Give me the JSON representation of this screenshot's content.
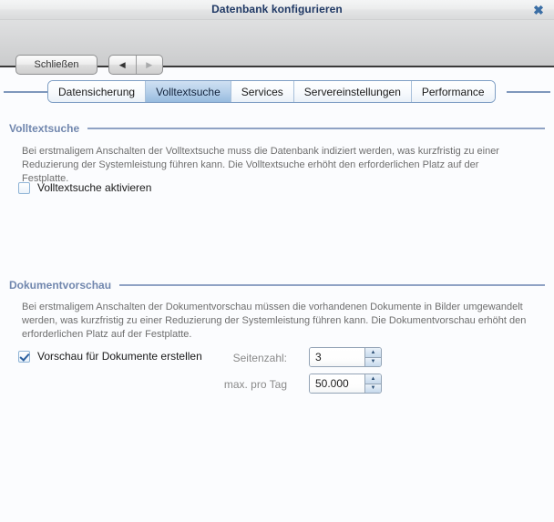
{
  "window": {
    "title": "Datenbank konfigurieren",
    "close_icon": "close-icon",
    "close_glyph": "✖"
  },
  "toolbar": {
    "close_label": "Schließen",
    "back_glyph": "◀",
    "forward_glyph": "▶",
    "back_icon": "arrow-left-icon",
    "forward_icon": "arrow-right-icon"
  },
  "tabs": [
    {
      "label": "Datensicherung",
      "selected": false
    },
    {
      "label": "Volltextsuche",
      "selected": true
    },
    {
      "label": "Services",
      "selected": false
    },
    {
      "label": "Servereinstellungen",
      "selected": false
    },
    {
      "label": "Performance",
      "selected": false
    }
  ],
  "sections": {
    "fulltext": {
      "title": "Volltextsuche",
      "description": "Bei erstmaligem Anschalten der Volltextsuche muss die Datenbank indiziert werden, was kurzfristig zu einer Reduzierung der Systemleistung führen kann. Die Volltextsuche erhöht den erforderlichen Platz auf der Festplatte.",
      "checkbox_label": "Volltextsuche aktivieren",
      "checked": false
    },
    "preview": {
      "title": "Dokumentvorschau",
      "description": "Bei erstmaligem Anschalten der Dokumentvorschau müssen die vorhandenen Dokumente in Bilder umgewandelt werden, was kurzfristig zu einer Reduzierung der Systemleistung führen kann. Die Dokumentvorschau erhöht den erforderlichen Platz auf der Festplatte.",
      "checkbox_label": "Vorschau für Dokumente erstellen",
      "checked": true,
      "fields": [
        {
          "label": "Seitenzahl:",
          "value": "3"
        },
        {
          "label": "max. pro Tag",
          "value": "50.000"
        }
      ]
    }
  },
  "colors": {
    "accent": "#7187ae",
    "tab_selected": "#97bbdf",
    "title_text": "#1f3864",
    "close_x": "#3b6ea5",
    "rule": "#8fa2c4"
  }
}
